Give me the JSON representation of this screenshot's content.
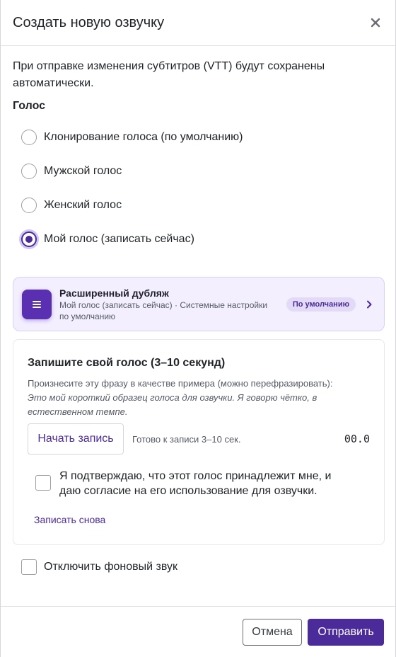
{
  "modal": {
    "title": "Создать новую озвучку",
    "close_icon": "close-icon"
  },
  "intro_text": "При отправке изменения субтитров (VTT) будут сохранены автоматически.",
  "voice": {
    "label": "Голос",
    "options": [
      {
        "label": "Клонирование голоса (по умолчанию)",
        "selected": false
      },
      {
        "label": "Мужской голос",
        "selected": false
      },
      {
        "label": "Женский голос",
        "selected": false
      },
      {
        "label": "Мой голос (записать сейчас)",
        "selected": true
      }
    ]
  },
  "dub": {
    "icon": "menu-lines-icon",
    "title": "Расширенный дубляж",
    "subtitle": "Мой голос (записать сейчас) · Системные настройки по умолчанию",
    "badge": "По умолчанию",
    "chevron": "chevron-right-icon"
  },
  "record": {
    "title": "Запишите свой голос (3–10 секунд)",
    "hint": "Произнесите эту фразу в качестве примера (можно перефразировать):",
    "phrase": "Это мой короткий образец голоса для озвучки. Я говорю чётко, в естественном темпе.",
    "start_label": "Начать запись",
    "status": "Готово к записи 3–10 сек.",
    "timer": "00.0",
    "consent_label": "Я подтверждаю, что этот голос принадлежит мне, и даю согласие на его использование для озвучки.",
    "consent_checked": false,
    "rerecord_label": "Записать снова"
  },
  "background": {
    "label": "Отключить фоновый звук",
    "checked": false
  },
  "footer": {
    "cancel_label": "Отмена",
    "submit_label": "Отправить"
  },
  "colors": {
    "accent": "#4b2a9a",
    "card_bg": "#f3efff",
    "badge_bg": "#e3daf8"
  }
}
